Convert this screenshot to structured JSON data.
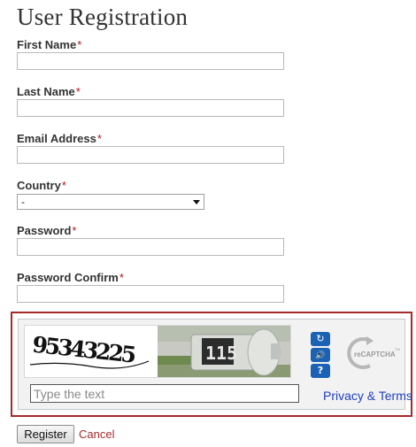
{
  "form": {
    "title": "User Registration",
    "required_marker": "*",
    "fields": [
      {
        "label": "First Name",
        "value": ""
      },
      {
        "label": "Last Name",
        "value": ""
      },
      {
        "label": "Email Address",
        "value": ""
      },
      {
        "label": "Country",
        "selected": "-"
      },
      {
        "label": "Password",
        "value": ""
      },
      {
        "label": "Password Confirm",
        "value": ""
      }
    ]
  },
  "captcha": {
    "challenge_text": "95343225",
    "photo_number": "115",
    "input_placeholder": "Type the text",
    "privacy_link": "Privacy & Terms",
    "logo_text": "reCAPTCHA",
    "logo_tm": "TM",
    "buttons": [
      {
        "icon": "refresh-icon",
        "glyph": "↻"
      },
      {
        "icon": "audio-icon",
        "glyph": "🔊"
      },
      {
        "icon": "help-icon",
        "glyph": "?"
      }
    ],
    "border_color": "#a52a2a",
    "accent_color": "#1b62b4"
  },
  "actions": {
    "register_label": "Register",
    "cancel_label": "Cancel"
  }
}
